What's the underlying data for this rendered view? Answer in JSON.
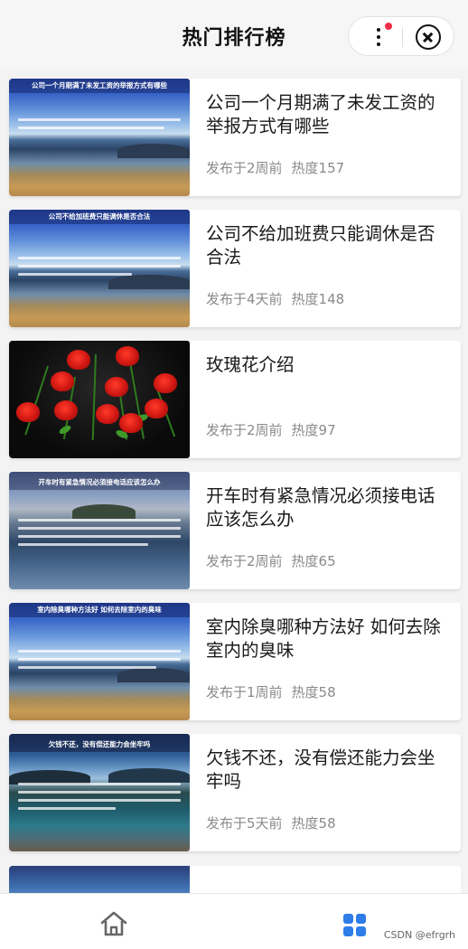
{
  "nav": {
    "title": "热门排行榜",
    "more_icon": "more-dots-icon",
    "close_icon": "close-circle-icon"
  },
  "articles": [
    {
      "title": "公司一个月期满了未发工资的举报方式有哪些",
      "posted": "发布于2周前",
      "heat": "热度157",
      "thumb_text": "公司一个月期满了未发工资的举报方式有哪些",
      "thumb_style": "lake"
    },
    {
      "title": "公司不给加班费只能调休是否合法",
      "posted": "发布于4天前",
      "heat": "热度148",
      "thumb_text": "公司不给加班费只能调休是否合法",
      "thumb_style": "lake"
    },
    {
      "title": "玫瑰花介绍",
      "posted": "发布于2周前",
      "heat": "热度97",
      "thumb_text": "",
      "thumb_style": "roses"
    },
    {
      "title": "开车时有紧急情况必须接电话应该怎么办",
      "posted": "发布于2周前",
      "heat": "热度65",
      "thumb_text": "开车时有紧急情况必须接电话应该怎么办",
      "thumb_style": "harbor"
    },
    {
      "title": "室内除臭哪种方法好 如何去除室内的臭味",
      "posted": "发布于1周前",
      "heat": "热度58",
      "thumb_text": "室内除臭哪种方法好 如何去除室内的臭味",
      "thumb_style": "lake"
    },
    {
      "title": "欠钱不还，没有偿还能力会坐牢吗",
      "posted": "发布于5天前",
      "heat": "热度58",
      "thumb_text": "欠钱不还，没有偿还能力会坐牢吗",
      "thumb_style": "mountain"
    }
  ],
  "tabbar": {
    "home_icon": "home-icon",
    "ranking_icon": "grid-icon"
  },
  "watermark": "CSDN @efrgrh",
  "colors": {
    "accent": "#2e7de8",
    "badge": "#f02e48",
    "meta": "#8a8a8a"
  }
}
